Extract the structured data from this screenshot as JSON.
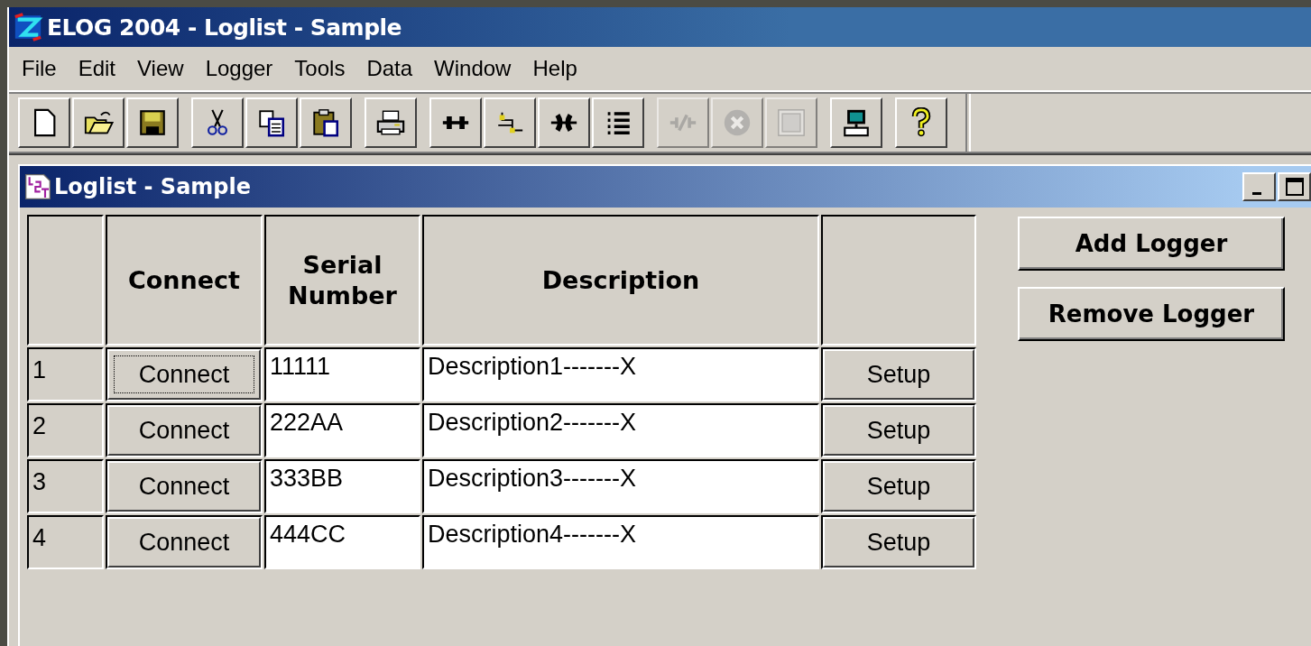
{
  "window": {
    "title": "ELOG 2004 - Loglist - Sample"
  },
  "menu": [
    "File",
    "Edit",
    "View",
    "Logger",
    "Tools",
    "Data",
    "Window",
    "Help"
  ],
  "toolbar": [
    [
      {
        "disabled": false
      },
      {
        "disabled": false
      },
      {
        "disabled": false
      }
    ],
    [
      {
        "disabled": false
      },
      {
        "disabled": false
      },
      {
        "disabled": false
      }
    ],
    [
      {
        "disabled": false
      }
    ],
    [
      {
        "disabled": false
      },
      {
        "disabled": false
      },
      {
        "disabled": false
      },
      {
        "disabled": false
      }
    ],
    [
      {
        "disabled": true
      },
      {
        "disabled": true
      },
      {
        "disabled": true
      }
    ],
    [
      {
        "disabled": false
      }
    ],
    [
      {
        "disabled": false
      }
    ]
  ],
  "child_window": {
    "title": "Loglist - Sample"
  },
  "table": {
    "columns": [
      "",
      "Connect",
      "Serial Number",
      "Description",
      ""
    ],
    "rows": [
      {
        "number": "1",
        "connect": "Connect",
        "focused": true,
        "serial": "11111",
        "description": "Description1-------X",
        "setup": "Setup"
      },
      {
        "number": "2",
        "connect": "Connect",
        "focused": false,
        "serial": "222AA",
        "description": "Description2-------X",
        "setup": "Setup"
      },
      {
        "number": "3",
        "connect": "Connect",
        "focused": false,
        "serial": "333BB",
        "description": "Description3-------X",
        "setup": "Setup"
      },
      {
        "number": "4",
        "connect": "Connect",
        "focused": false,
        "serial": "444CC",
        "description": "Description4-------X",
        "setup": "Setup"
      }
    ]
  },
  "buttons": [
    "Add Logger",
    "Remove Logger"
  ]
}
